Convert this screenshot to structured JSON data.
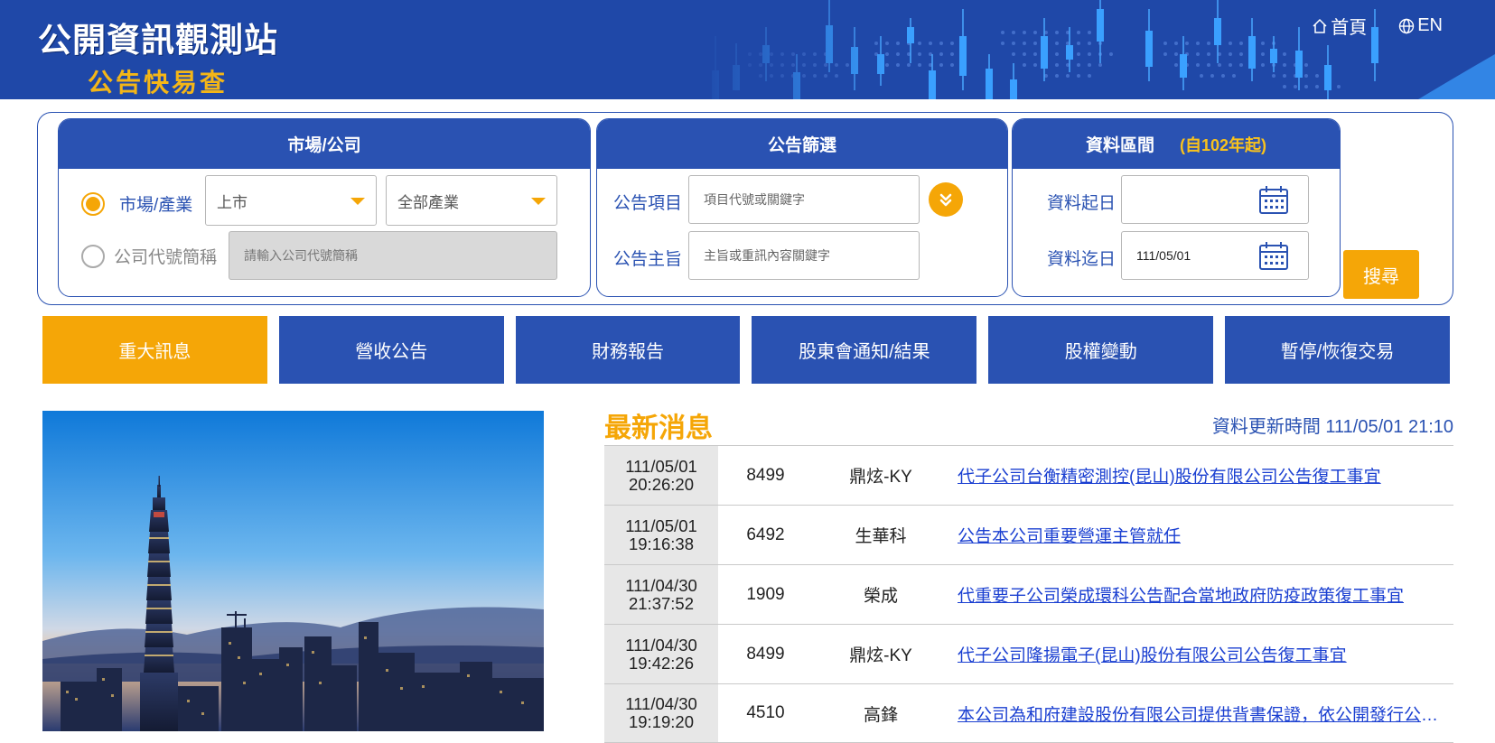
{
  "header": {
    "logo_title": "公開資訊觀測站",
    "logo_subtitle": "公告快易查",
    "nav": [
      {
        "label": "首頁",
        "icon": "home-icon"
      },
      {
        "label": "EN",
        "icon": "globe-icon"
      }
    ]
  },
  "search": {
    "market_box": {
      "title": "市場/公司",
      "radio_market_label": "市場/產業",
      "market_select_value": "上市",
      "industry_select_value": "全部產業",
      "radio_company_label": "公司代號簡稱",
      "company_placeholder": "請輸入公司代號簡稱"
    },
    "filter_box": {
      "title": "公告篩選",
      "item_label": "公告項目",
      "item_placeholder": "項目代號或關鍵字",
      "subject_label": "公告主旨",
      "subject_placeholder": "主旨或重訊內容關鍵字"
    },
    "date_box": {
      "title": "資料區間",
      "note": "(自102年起)",
      "start_label": "資料起日",
      "start_value": "",
      "end_label": "資料迄日",
      "end_value": "111/05/01"
    },
    "search_button": "搜尋"
  },
  "tabs": [
    {
      "label": "重大訊息",
      "active": true
    },
    {
      "label": "營收公告",
      "active": false
    },
    {
      "label": "財務報告",
      "active": false
    },
    {
      "label": "股東會通知/結果",
      "active": false
    },
    {
      "label": "股權變動",
      "active": false
    },
    {
      "label": "暫停/恢復交易",
      "active": false
    }
  ],
  "news": {
    "title": "最新消息",
    "updated": "資料更新時間 111/05/01 21:10",
    "rows": [
      {
        "date": "111/05/01",
        "time": "20:26:20",
        "code": "8499",
        "name": "鼎炫-KY",
        "subject": "代子公司台衡精密測控(昆山)股份有限公司公告復工事宜"
      },
      {
        "date": "111/05/01",
        "time": "19:16:38",
        "code": "6492",
        "name": "生華科",
        "subject": "公告本公司重要營運主管就任"
      },
      {
        "date": "111/04/30",
        "time": "21:37:52",
        "code": "1909",
        "name": "榮成",
        "subject": "代重要子公司榮成環科公告配合當地政府防疫政策復工事宜"
      },
      {
        "date": "111/04/30",
        "time": "19:42:26",
        "code": "8499",
        "name": "鼎炫-KY",
        "subject": "代子公司隆揚電子(昆山)股份有限公司公告復工事宜"
      },
      {
        "date": "111/04/30",
        "time": "19:19:20",
        "code": "4510",
        "name": "高鋒",
        "subject": "本公司為和府建設股份有限公司提供背書保證，依公開發行公司資金貸與及背書保證處理準則第二十五條第一項第四款規定公告"
      }
    ]
  },
  "colors": {
    "brand_blue": "#2a52b2",
    "header_blue": "#1f48a8",
    "accent_orange": "#f5a607",
    "link_blue": "#1a3fd1"
  }
}
